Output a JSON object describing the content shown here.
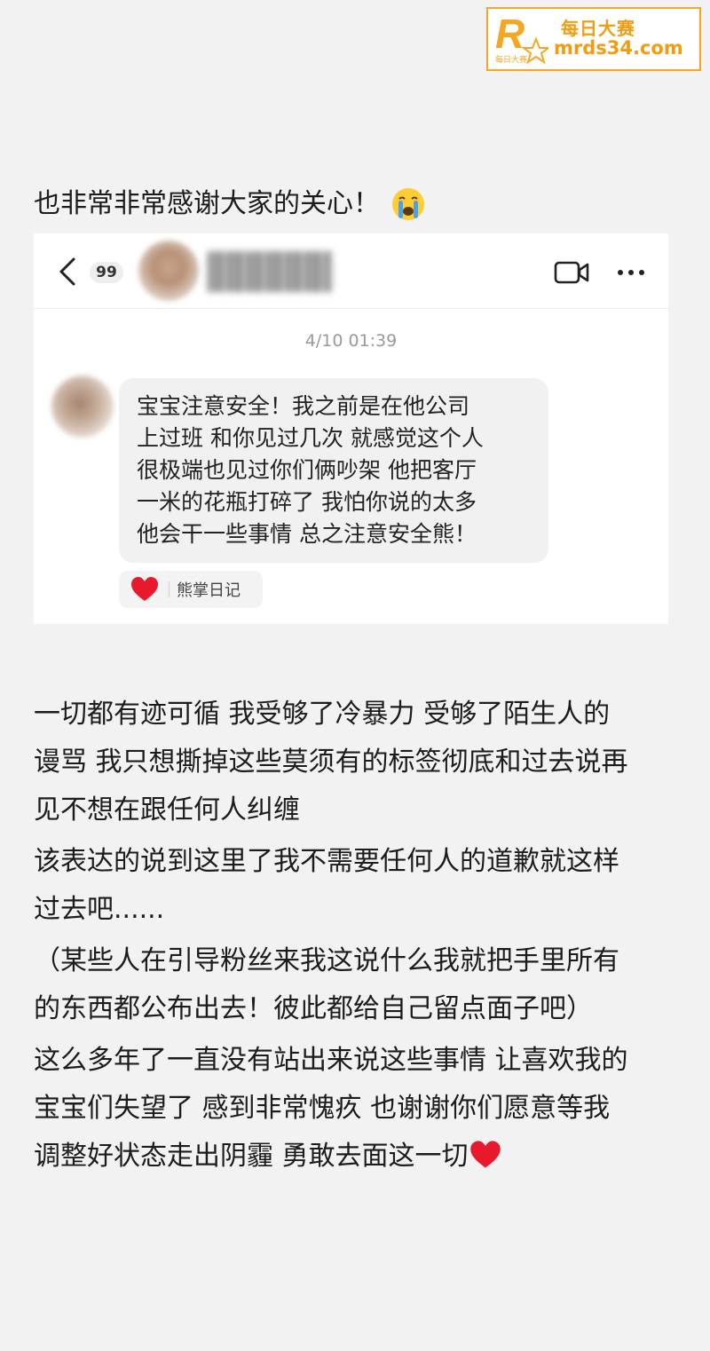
{
  "watermark": {
    "logo_letter": "R",
    "logo_caption": "每日大赛",
    "title": "每日大赛",
    "url": "mrds34.com"
  },
  "intro": {
    "text": "也非常非常感谢大家的关心！",
    "icon": "crying-face-emoji"
  },
  "chat": {
    "unread_count": "99",
    "timestamp": "4/10 01:39",
    "message_lines": [
      "宝宝注意安全！我之前是在他公司",
      "上过班 和你见过几次 就感觉这个人",
      "很极端也见过你们俩吵架 他把客厅",
      "一米的花瓶打碎了 我怕你说的太多",
      "他会干一些事情 总之注意安全熊！"
    ],
    "reaction": {
      "icon": "heart-icon",
      "name": "熊掌日记"
    },
    "icons": [
      "back-chevron-icon",
      "video-call-icon",
      "more-options-icon"
    ]
  },
  "body": {
    "p1": [
      " 一切都有迹可循 我受够了冷暴力 受够了陌生人的",
      "谩骂 我只想撕掉这些莫须有的标签彻底和过去说再",
      "见不想在跟任何人纠缠"
    ],
    "p2": [
      "该表达的说到这里了我不需要任何人的道歉就这样",
      "过去吧......"
    ],
    "p3": [
      " （某些人在引导粉丝来我这说什么我就把手里所有",
      "的东西都公布出去！彼此都给自己留点面子吧）"
    ],
    "p4": [
      "这么多年了一直没有站出来说这些事情 让喜欢我的",
      "宝宝们失望了  感到非常愧疚  也谢谢你们愿意等我",
      "调整好状态走出阴霾 勇敢去面这一切"
    ]
  },
  "colors": {
    "background": "#f2f2f2",
    "watermark": "#f39c12",
    "heart": "#e8192c",
    "bubble": "#f1f1f1"
  }
}
